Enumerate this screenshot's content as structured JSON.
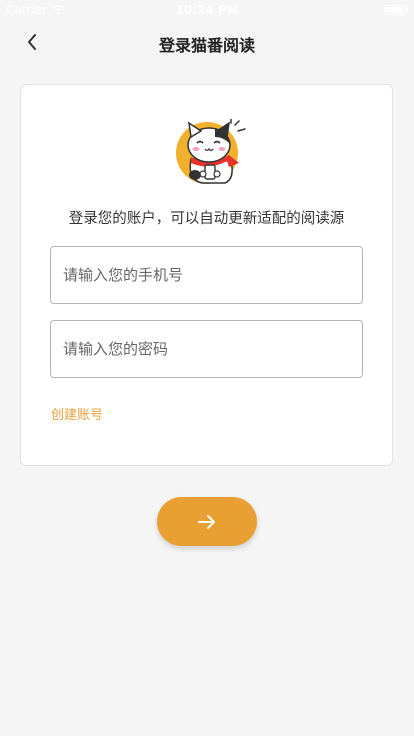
{
  "status_bar": {
    "carrier": "Carrier",
    "time": "10:24 PM"
  },
  "nav": {
    "title": "登录猫番阅读"
  },
  "login": {
    "subtitle": "登录您的账户，可以自动更新适配的阅读源",
    "phone_placeholder": "请输入您的手机号",
    "password_placeholder": "请输入您的密码",
    "create_account": "创建账号"
  },
  "icons": {
    "back": "chevron-left-icon",
    "submit": "arrow-right-icon",
    "mascot": "cat-mascot"
  },
  "colors": {
    "accent": "#e8a032",
    "link": "#e8a13a",
    "background": "#f5f5f5",
    "card": "#ffffff"
  }
}
